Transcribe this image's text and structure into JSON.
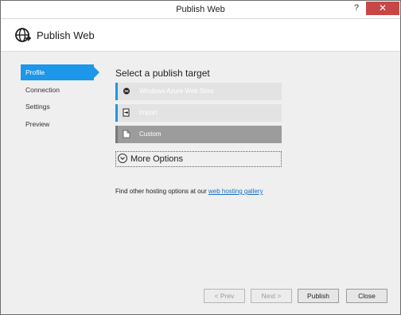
{
  "window": {
    "title": "Publish Web",
    "help": "?",
    "close": "✕"
  },
  "header": {
    "title": "Publish Web"
  },
  "nav": {
    "items": [
      {
        "label": "Profile"
      },
      {
        "label": "Connection"
      },
      {
        "label": "Settings"
      },
      {
        "label": "Preview"
      }
    ]
  },
  "main": {
    "heading": "Select a publish target",
    "targets": [
      {
        "label": "Windows Azure Web Sites",
        "icon": "azure-icon"
      },
      {
        "label": "Import",
        "icon": "import-icon"
      },
      {
        "label": "Custom",
        "icon": "document-icon"
      }
    ],
    "more_options": "More Options",
    "hosting_text": "Find other hosting options at our",
    "hosting_link": "web hosting gallery"
  },
  "buttons": {
    "prev": "< Prev",
    "next": "Next >",
    "publish": "Publish",
    "close": "Close"
  },
  "colors": {
    "accent": "#1c97ea",
    "selected": "#9c9c9c",
    "close_button": "#c74747"
  }
}
